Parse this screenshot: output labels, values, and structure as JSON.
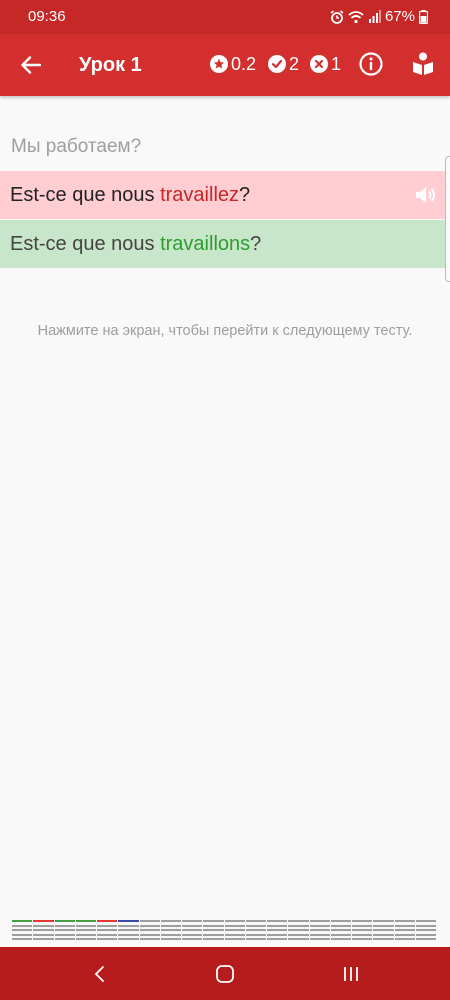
{
  "status_bar": {
    "time": "09:36",
    "battery": "67%"
  },
  "app_bar": {
    "title": "Урок 1",
    "stats": {
      "score": "0.2",
      "correct_count": "2",
      "wrong_count": "1"
    }
  },
  "exercise": {
    "prompt": "Мы работаем?",
    "user_answer": {
      "prefix": "Est-ce que nous ",
      "highlight": "travaillez",
      "suffix": "?"
    },
    "correct_answer": {
      "prefix": "Est-ce que nous ",
      "highlight": "travaillons",
      "suffix": "?"
    },
    "hint": "Нажмите на экран, чтобы перейти к следующему тесту."
  },
  "progress": {
    "total": 20,
    "results": [
      "correct",
      "wrong",
      "correct",
      "correct",
      "wrong",
      "current"
    ]
  },
  "colors": {
    "status_bar": "#c62828",
    "app_bar": "#d32f2f",
    "nav_bar": "#b71c1c",
    "wrong_bg": "#ffcdd2",
    "correct_bg": "#c8e6c9",
    "wrong_text": "#c62828",
    "correct_text": "#2e9c2e",
    "progress_correct": "#43a047",
    "progress_wrong": "#e53935",
    "progress_current": "#3949ab"
  },
  "icons": {
    "back": "arrow-left-icon",
    "score": "star-icon",
    "correct": "check-circle-icon",
    "wrong": "x-circle-icon",
    "info": "info-icon",
    "book": "book-reader-icon",
    "speaker": "speaker-icon"
  }
}
